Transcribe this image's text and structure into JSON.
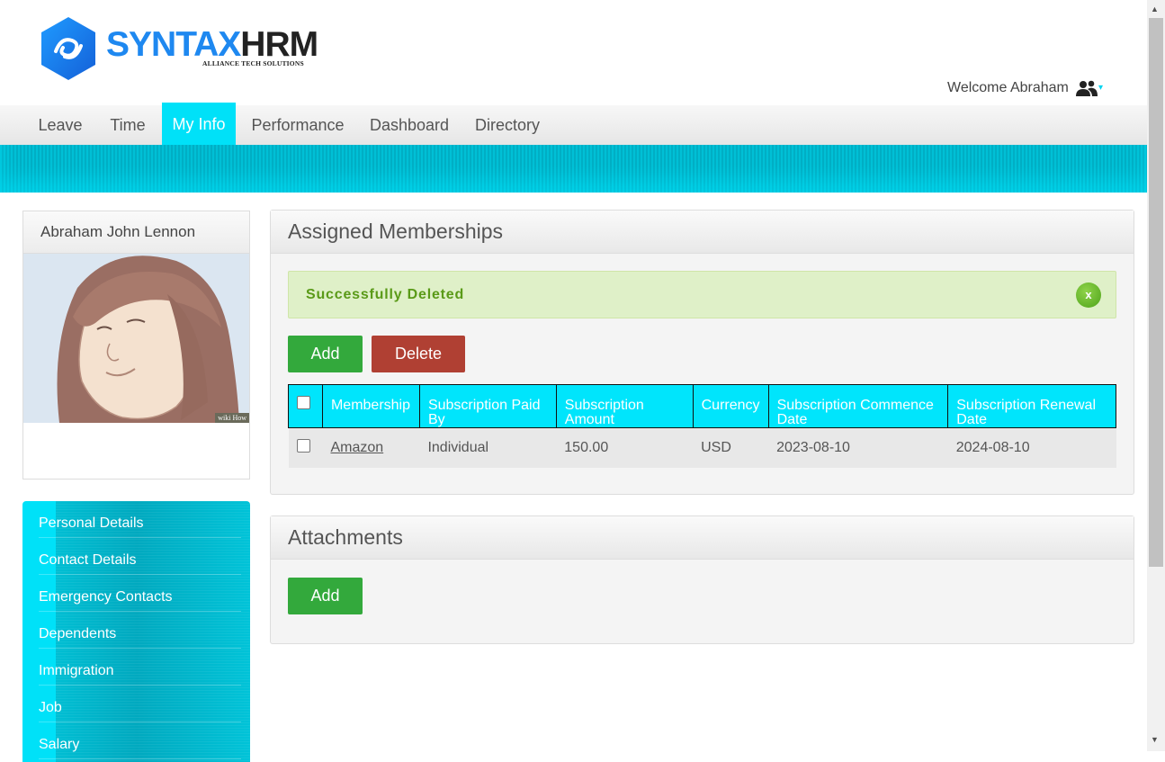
{
  "brand": {
    "logo_main": "SYNTAX",
    "logo_accent": "HRM",
    "tagline": "ALLIANCE TECH SOLUTIONS",
    "logo_color": "#1e88f0"
  },
  "header": {
    "welcome": "Welcome Abraham",
    "user_icon": "users-icon",
    "menu_caret": "▾"
  },
  "nav": {
    "items": [
      {
        "label": "Leave",
        "active": false
      },
      {
        "label": "Time",
        "active": false
      },
      {
        "label": "My Info",
        "active": true
      },
      {
        "label": "Performance",
        "active": false
      },
      {
        "label": "Dashboard",
        "active": false
      },
      {
        "label": "Directory",
        "active": false
      }
    ],
    "accent_color": "#00e1f8"
  },
  "profile": {
    "name": "Abraham John Lennon",
    "photo_caption": "wiki How"
  },
  "sidemenu": {
    "items": [
      "Personal Details",
      "Contact Details",
      "Emergency Contacts",
      "Dependents",
      "Immigration",
      "Job",
      "Salary"
    ]
  },
  "memberships": {
    "title": "Assigned Memberships",
    "alert": "Successfully Deleted",
    "alert_close": "x",
    "add_label": "Add",
    "delete_label": "Delete",
    "columns": [
      "Membership",
      "Subscription Paid By",
      "Subscription Amount",
      "Currency",
      "Subscription Commence Date",
      "Subscription Renewal Date"
    ],
    "rows": [
      {
        "membership": "Amazon",
        "paid_by": "Individual",
        "amount": "150.00",
        "currency": "USD",
        "commence": "2023-08-10",
        "renewal": "2024-08-10"
      }
    ]
  },
  "attachments": {
    "title": "Attachments",
    "add_label": "Add"
  },
  "colors": {
    "success_bg": "#dff0c8",
    "success_text": "#5a9a18",
    "add_button": "#33a93c",
    "delete_button": "#b04033",
    "table_header": "#00e5fc"
  }
}
